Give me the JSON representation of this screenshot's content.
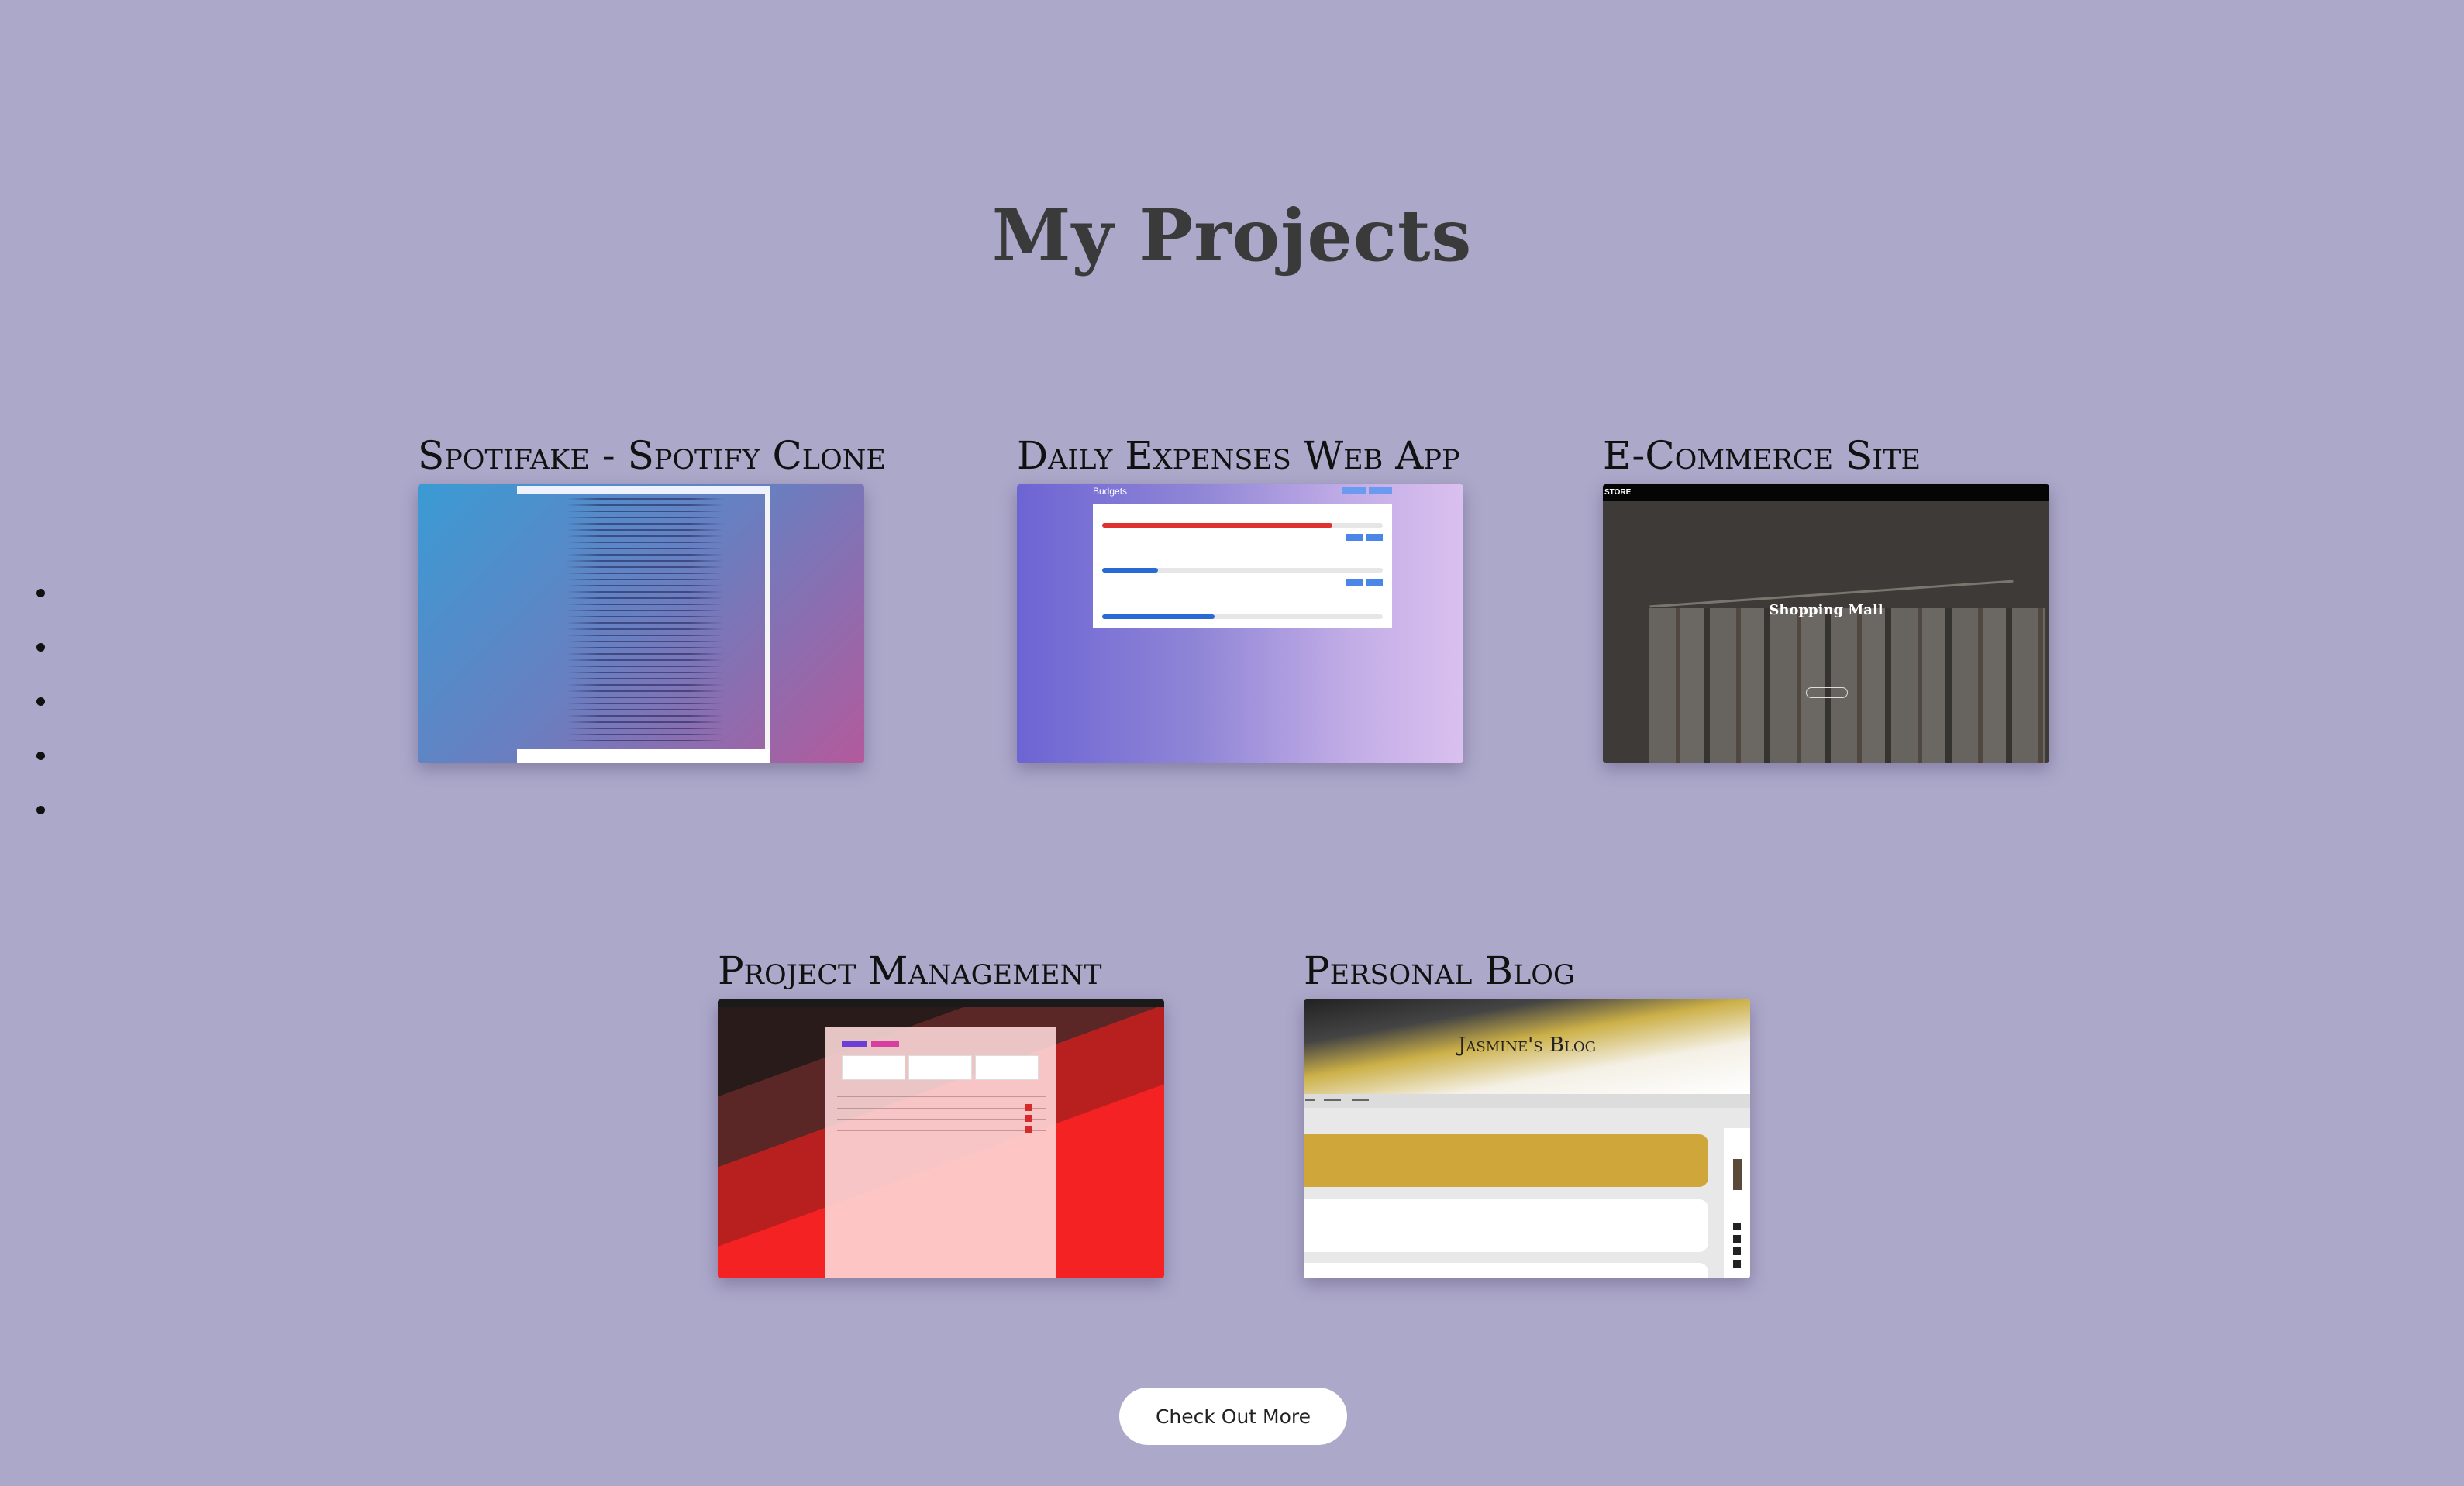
{
  "page": {
    "title": "My Projects"
  },
  "projects": [
    {
      "title": "Spotifake - Spotify Clone"
    },
    {
      "title": "Daily Expenses Web App",
      "thumb": {
        "header": "Budgets"
      }
    },
    {
      "title": "E-Commerce Site",
      "thumb": {
        "nav": "STORE",
        "hero": "Shopping Mall"
      }
    },
    {
      "title": "Project Management"
    },
    {
      "title": "Personal Blog",
      "thumb": {
        "hero": "Jasmine's Blog"
      }
    }
  ],
  "actions": {
    "more_label": "Check Out More"
  },
  "colors": {
    "background": "#aca8ca",
    "title": "#3a3a3a",
    "button_bg": "#ffffff"
  },
  "side_nav": {
    "items": [
      "",
      "",
      "",
      "",
      ""
    ]
  }
}
